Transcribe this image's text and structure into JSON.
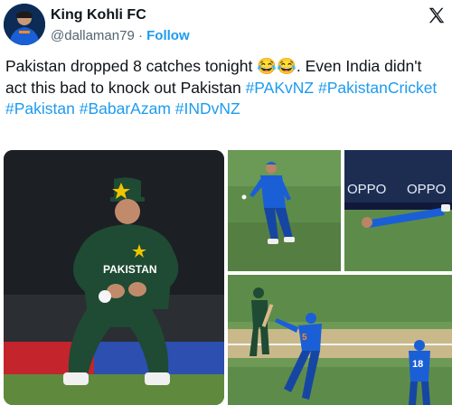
{
  "account": {
    "display_name": "King Kohli FC",
    "handle": "@dallaman79",
    "separator": "·",
    "follow_label": "Follow"
  },
  "icons": {
    "brand": "x-logo-icon",
    "avatar": "cricketer-avatar"
  },
  "tweet": {
    "text_before_emoji": "Pakistan dropped 8 catches tonight ",
    "emoji": "😂😂",
    "text_after_emoji": ". Even India didn't act this bad to knock out Pakistan ",
    "hashtags": [
      "#PAKvNZ",
      "#PakistanCricket",
      "#Pakistan",
      "#BabarAzam",
      "#INDvNZ"
    ]
  },
  "media": {
    "panel_1": {
      "jersey_text": "PAKISTAN"
    },
    "panel_3": {
      "ad_text": "OPPO"
    },
    "panel_4": {
      "jersey_number": "18"
    }
  },
  "colors": {
    "link": "#1d9bf0",
    "text": "#0f1419",
    "secondary": "#536471",
    "india_blue": "#1a5fd6",
    "pakistan_green": "#1f4a33",
    "pitch_green": "#5d8c4a"
  }
}
